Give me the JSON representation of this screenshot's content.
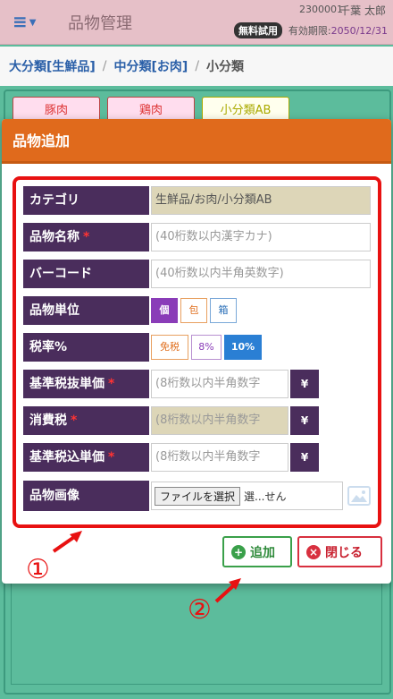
{
  "header": {
    "app_title": "品物管理",
    "user_id": "2300001",
    "user_name": "千葉 太郎",
    "trial_badge": "無料試用",
    "expiry_label": "有効期限:",
    "expiry_date": "2050/12/31"
  },
  "breadcrumb": {
    "major": "大分類[生鮮品]",
    "middle": "中分類[お肉]",
    "minor": "小分類"
  },
  "categories": [
    "豚肉",
    "鶏肉",
    "小分類AB"
  ],
  "modal": {
    "title": "品物追加",
    "fields": {
      "category_label": "カテゴリ",
      "category_value": "生鮮品/お肉/小分類AB",
      "name_label": "品物名称",
      "name_placeholder": "(40桁数以内漢字カナ)",
      "barcode_label": "バーコード",
      "barcode_placeholder": "(40桁数以内半角英数字)",
      "unit_label": "品物単位",
      "unit_options": [
        "個",
        "包",
        "箱"
      ],
      "tax_label": "税率%",
      "tax_options": [
        "免税",
        "8%",
        "10%"
      ],
      "base_price_label": "基準税抜単価",
      "base_price_placeholder": "(8桁数以内半角数字",
      "consumption_tax_label": "消費税",
      "consumption_tax_placeholder": "(8桁数以内半角数字",
      "taxed_price_label": "基準税込単価",
      "taxed_price_placeholder": "(8桁数以内半角数字",
      "yen": "¥",
      "image_label": "品物画像",
      "file_button": "ファイルを選択",
      "file_status": "選...せん"
    },
    "add_button": "追加",
    "close_button": "閉じる"
  },
  "annotations": [
    "①",
    "②"
  ],
  "colors": {
    "header_bg": "#e6c0c8",
    "modal_header": "#e06a1c",
    "label_bg": "#4a2d5c",
    "highlight": "#e81111",
    "accent_blue": "#2a7fd4"
  }
}
